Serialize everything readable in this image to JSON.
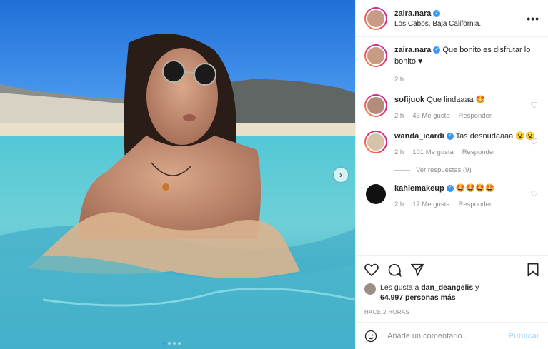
{
  "post": {
    "username": "zaira.nara",
    "location": "Los Cabos, Baja California.",
    "more_label": "•••",
    "caption": "Que bonito es disfrutar lo bonito ♥",
    "caption_time": "2 h"
  },
  "comments": [
    {
      "username": "sofijuok",
      "text": "Que lindaaaa 🤩",
      "time": "2 h",
      "likes": "43 Me gusta",
      "reply": "Responder",
      "verified": false
    },
    {
      "username": "wanda_icardi",
      "text": "Tas desnudaaaa 😮😮",
      "time": "2 h",
      "likes": "101 Me gusta",
      "reply": "Responder",
      "verified": true,
      "view_replies": "Ver respuestas (9)"
    },
    {
      "username": "kahlemakeup",
      "text": "🤩🤩🤩🤩",
      "time": "2 h",
      "likes": "17 Me gusta",
      "reply": "Responder",
      "verified": true
    }
  ],
  "likes": {
    "prefix": "Les gusta a",
    "user": "dan_deangelis",
    "suffix": "y",
    "count": "64.997 personas más"
  },
  "timestamp": "HACE 2 HORAS",
  "add_comment": {
    "placeholder": "Añade un comentario...",
    "publish": "Publicar"
  },
  "carousel": {
    "total": 4,
    "active": 1
  },
  "colors": {
    "accent": "#3897f0",
    "muted": "#8e8e8e",
    "text": "#262626"
  },
  "icons": [
    "heart-icon",
    "comment-icon",
    "share-icon",
    "bookmark-icon",
    "emoji-icon",
    "chevron-right-icon",
    "more-icon",
    "verified-icon"
  ]
}
